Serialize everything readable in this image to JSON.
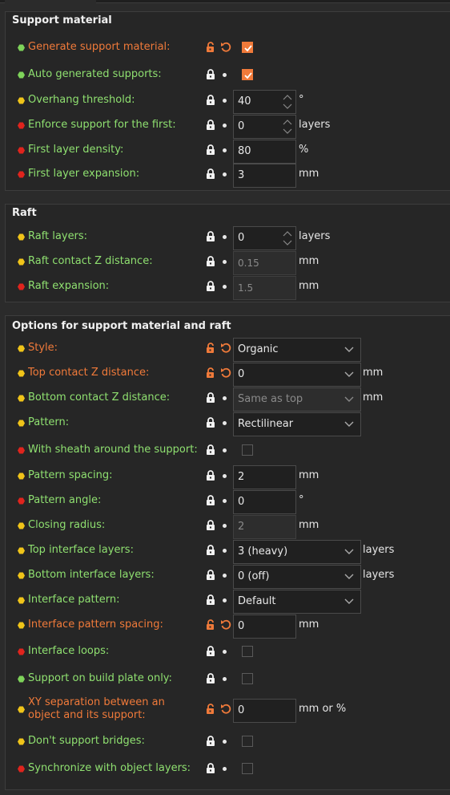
{
  "groups": [
    {
      "title": "Support material"
    },
    {
      "title": "Raft"
    },
    {
      "title": "Options for support material and raft"
    }
  ],
  "support": {
    "generate": {
      "label": "Generate support material:",
      "checked": true
    },
    "auto": {
      "label": "Auto generated supports:",
      "checked": true
    },
    "overhang": {
      "label": "Overhang threshold:",
      "value": "40",
      "unit": "°"
    },
    "enforce": {
      "label": "Enforce support for the first:",
      "value": "0",
      "unit": "layers"
    },
    "first_density": {
      "label": "First layer density:",
      "value": "80",
      "unit": "%"
    },
    "first_expansion": {
      "label": "First layer expansion:",
      "value": "3",
      "unit": "mm"
    }
  },
  "raft": {
    "layers": {
      "label": "Raft layers:",
      "value": "0",
      "unit": "layers"
    },
    "contact_z": {
      "label": "Raft contact Z distance:",
      "value": "0.15",
      "unit": "mm"
    },
    "expansion": {
      "label": "Raft expansion:",
      "value": "1.5",
      "unit": "mm"
    }
  },
  "options": {
    "style": {
      "label": "Style:",
      "value": "Organic"
    },
    "top_contact": {
      "label": "Top contact Z distance:",
      "value": "0",
      "unit": "mm"
    },
    "bottom_contact": {
      "label": "Bottom contact Z distance:",
      "value": "Same as top",
      "unit": "mm"
    },
    "pattern": {
      "label": "Pattern:",
      "value": "Rectilinear"
    },
    "sheath": {
      "label": "With sheath around the support:",
      "checked": false
    },
    "pattern_spacing": {
      "label": "Pattern spacing:",
      "value": "2",
      "unit": "mm"
    },
    "pattern_angle": {
      "label": "Pattern angle:",
      "value": "0",
      "unit": "°"
    },
    "closing_radius": {
      "label": "Closing radius:",
      "value": "2",
      "unit": "mm"
    },
    "top_interface": {
      "label": "Top interface layers:",
      "value": "3 (heavy)",
      "unit": "layers"
    },
    "bottom_interface": {
      "label": "Bottom interface layers:",
      "value": "0 (off)",
      "unit": "layers"
    },
    "interface_pattern": {
      "label": "Interface pattern:",
      "value": "Default"
    },
    "interface_spacing": {
      "label": "Interface pattern spacing:",
      "value": "0",
      "unit": "mm"
    },
    "interface_loops": {
      "label": "Interface loops:",
      "checked": false
    },
    "build_plate_only": {
      "label": "Support on build plate only:",
      "checked": false
    },
    "xy_separation": {
      "label_line1": "XY separation between an",
      "label_line2": "object and its support:",
      "value": "0",
      "unit": "mm or %"
    },
    "dont_support_bridges": {
      "label": "Don't support bridges:",
      "checked": false
    },
    "sync_layers": {
      "label": "Synchronize with object layers:",
      "checked": false
    }
  },
  "colors": {
    "green": "#8fe070",
    "orange": "#f07a3a",
    "yellow": "#f0c419",
    "red": "#e0241d",
    "background": "#2b2b2b"
  }
}
